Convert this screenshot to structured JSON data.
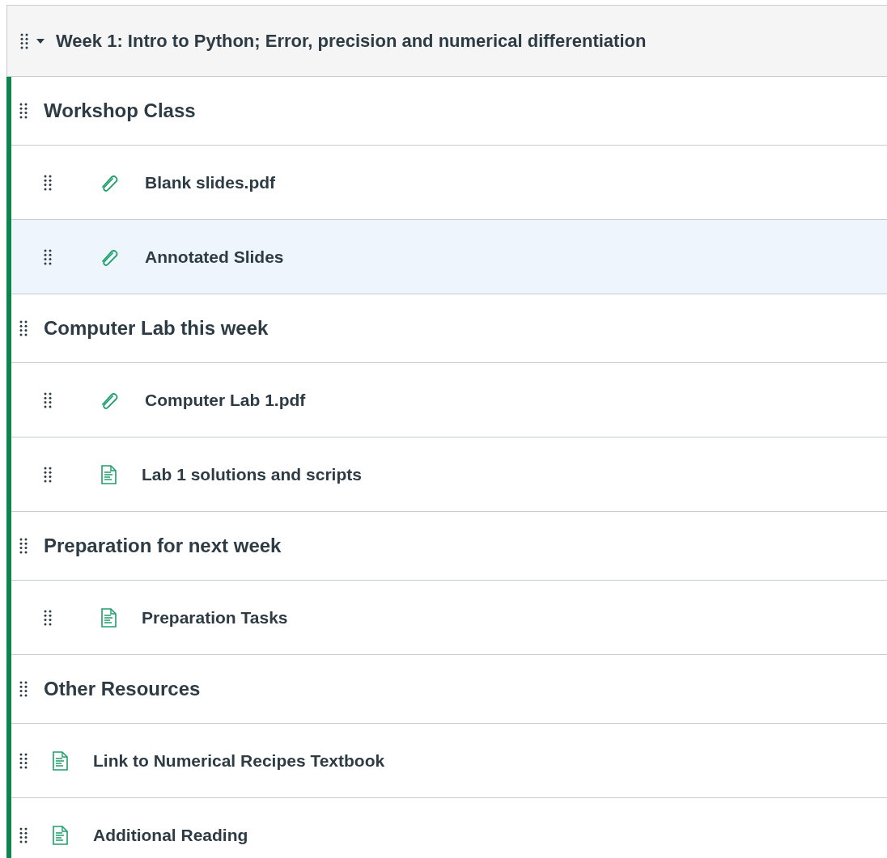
{
  "module": {
    "title": "Week 1: Intro to Python; Error, precision and numerical differentiation",
    "expanded": true,
    "items": [
      {
        "kind": "header",
        "title": "Workshop Class",
        "highlighted": false
      },
      {
        "kind": "attachment",
        "title": "Blank slides.pdf",
        "indented": true,
        "highlighted": false
      },
      {
        "kind": "attachment",
        "title": "Annotated Slides",
        "indented": true,
        "highlighted": true
      },
      {
        "kind": "header",
        "title": "Computer Lab this week",
        "highlighted": false
      },
      {
        "kind": "attachment",
        "title": "Computer Lab 1.pdf",
        "indented": true,
        "highlighted": false
      },
      {
        "kind": "page",
        "title": "Lab 1 solutions and scripts",
        "indented": true,
        "highlighted": false
      },
      {
        "kind": "header",
        "title": "Preparation for next week",
        "highlighted": false
      },
      {
        "kind": "page",
        "title": "Preparation Tasks",
        "indented": true,
        "highlighted": false
      },
      {
        "kind": "header",
        "title": "Other Resources",
        "highlighted": false
      },
      {
        "kind": "page",
        "title": "Link to Numerical Recipes Textbook",
        "indented": false,
        "highlighted": false
      },
      {
        "kind": "page",
        "title": "Additional Reading",
        "indented": false,
        "highlighted": false
      }
    ]
  }
}
